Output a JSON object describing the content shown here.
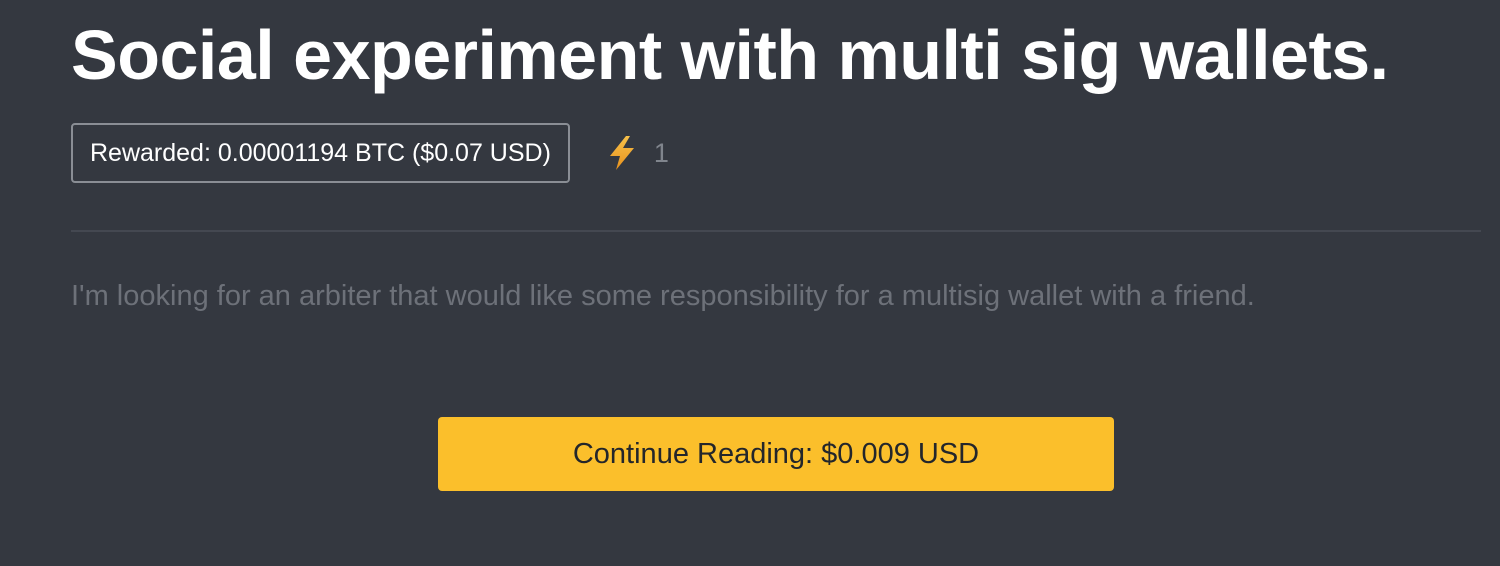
{
  "post": {
    "title": "Social experiment with multi sig wallets.",
    "reward_label": "Rewarded: 0.00001194 BTC ($0.07 USD)",
    "boost_icon": "lightning-bolt-icon",
    "boost_count": "1",
    "excerpt": "I'm looking for an arbiter that would like some responsibility for a multisig wallet with a friend.",
    "continue_label": "Continue Reading: $0.009 USD"
  },
  "colors": {
    "background": "#343840",
    "accent": "#fbbf2b",
    "bolt": "#f5a623"
  }
}
